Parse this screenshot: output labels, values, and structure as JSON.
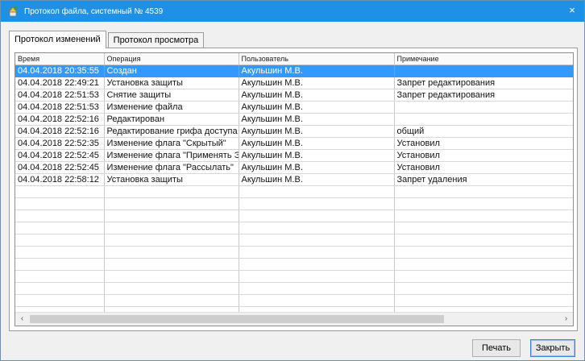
{
  "window": {
    "title": "Протокол файла, системный № 4539",
    "close_glyph": "×"
  },
  "tabs": [
    {
      "label": "Протокол изменений",
      "active": true
    },
    {
      "label": "Протокол просмотра",
      "active": false
    }
  ],
  "table": {
    "columns": [
      "Время",
      "Операция",
      "Пользователь",
      "Примечание"
    ],
    "rows": [
      [
        "04.04.2018 20:35:55",
        "Создан",
        "Акульшин М.В.",
        ""
      ],
      [
        "04.04.2018 22:49:21",
        "Установка защиты",
        "Акульшин М.В.",
        "Запрет редактирования"
      ],
      [
        "04.04.2018 22:51:53",
        "Снятие защиты",
        "Акульшин М.В.",
        "Запрет редактирования"
      ],
      [
        "04.04.2018 22:51:53",
        "Изменение файла",
        "Акульшин М.В.",
        ""
      ],
      [
        "04.04.2018 22:52:16",
        "Редактирован",
        "Акульшин М.В.",
        ""
      ],
      [
        "04.04.2018 22:52:16",
        "Редактирование грифа доступа",
        "Акульшин М.В.",
        "общий"
      ],
      [
        "04.04.2018 22:52:35",
        "Изменение флага \"Скрытый\"",
        "Акульшин М.В.",
        "Установил"
      ],
      [
        "04.04.2018 22:52:45",
        "Изменение флага \"Применять ЭП",
        "Акульшин М.В.",
        "Установил"
      ],
      [
        "04.04.2018 22:52:45",
        "Изменение флага \"Рассылать\"",
        "Акульшин М.В.",
        "Установил"
      ],
      [
        "04.04.2018 22:58:12",
        "Установка защиты",
        "Акульшин М.В.",
        "Запрет удаления"
      ]
    ],
    "selected_row": 0,
    "empty_rows": 11
  },
  "scrollbar": {
    "left_glyph": "‹",
    "right_glyph": "›"
  },
  "buttons": {
    "print_label": "Печать",
    "close_label": "Закрыть"
  },
  "colors": {
    "titlebar": "#1e90e6",
    "selection": "#3399ff"
  },
  "icons": {
    "app": "app-icon",
    "close": "close-icon"
  }
}
